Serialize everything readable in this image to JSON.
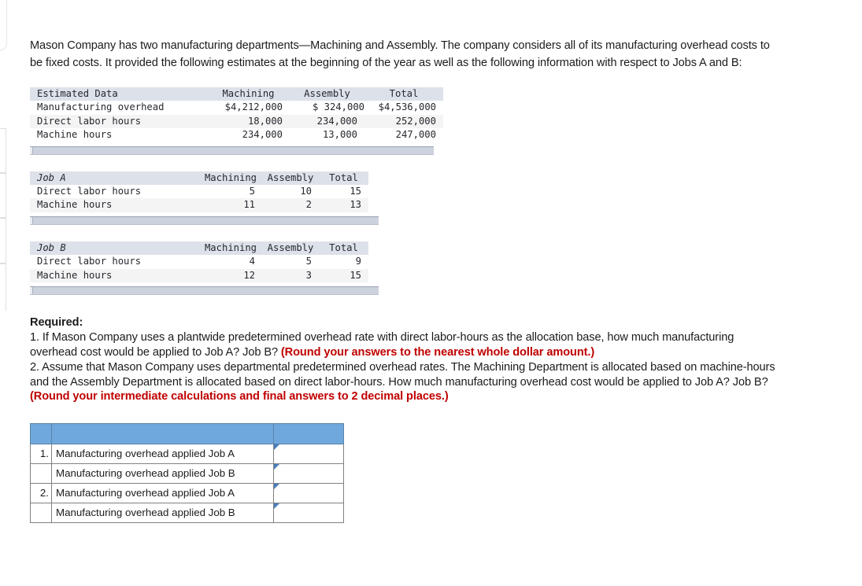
{
  "problem": {
    "intro": "Mason Company has two manufacturing departments—Machining and Assembly. The company considers all of its manufacturing overhead costs to be fixed costs. It provided the following estimates at the beginning of the year as well as the following information with respect to Jobs A and B:"
  },
  "estimated_data_table": {
    "title": "Estimated Data",
    "columns": [
      "Machining",
      "Assembly",
      "Total"
    ],
    "rows": [
      {
        "label": "Manufacturing overhead",
        "machining": "$4,212,000",
        "assembly": "$  324,000",
        "total": "$4,536,000"
      },
      {
        "label": "Direct labor hours",
        "machining": "18,000",
        "assembly": "234,000",
        "total": "252,000"
      },
      {
        "label": "Machine hours",
        "machining": "234,000",
        "assembly": "13,000",
        "total": "247,000"
      }
    ]
  },
  "job_a_table": {
    "title": "Job A",
    "columns": [
      "Machining",
      "Assembly",
      "Total"
    ],
    "rows": [
      {
        "label": "Direct labor hours",
        "machining": "5",
        "assembly": "10",
        "total": "15"
      },
      {
        "label": "Machine hours",
        "machining": "11",
        "assembly": "2",
        "total": "13"
      }
    ]
  },
  "job_b_table": {
    "title": "Job B",
    "columns": [
      "Machining",
      "Assembly",
      "Total"
    ],
    "rows": [
      {
        "label": "Direct labor hours",
        "machining": "4",
        "assembly": "5",
        "total": "9"
      },
      {
        "label": "Machine hours",
        "machining": "12",
        "assembly": "3",
        "total": "15"
      }
    ]
  },
  "required": {
    "heading": "Required:",
    "q1_text": "1. If Mason Company uses a plantwide predetermined overhead rate with direct labor-hours as the allocation base, how much manufacturing overhead cost would be applied to Job A? Job B? ",
    "q1_note": "(Round your answers to the nearest whole dollar amount.)",
    "q2_text": "2. Assume that Mason Company uses departmental predetermined overhead rates. The Machining Department is allocated based on machine-hours and the Assembly Department is allocated based on direct labor-hours. How much manufacturing overhead cost would be applied to Job A? Job B? ",
    "q2_note": "(Round your intermediate calculations and final answers to 2 decimal places.)"
  },
  "answer_table": {
    "header": {
      "num": "",
      "label": "",
      "value": ""
    },
    "rows": [
      {
        "num": "1.",
        "label": "Manufacturing overhead applied Job A",
        "value": ""
      },
      {
        "num": "",
        "label": "Manufacturing overhead applied Job B",
        "value": ""
      },
      {
        "num": "2.",
        "label": "Manufacturing overhead applied Job A",
        "value": ""
      },
      {
        "num": "",
        "label": "Manufacturing overhead applied Job B",
        "value": ""
      }
    ]
  },
  "colors": {
    "answer_header_blue": "#6fa8dc",
    "input_border_blue": "#4a7ebb",
    "table_header_gray": "#dde1e9",
    "note_red": "#c00000"
  }
}
